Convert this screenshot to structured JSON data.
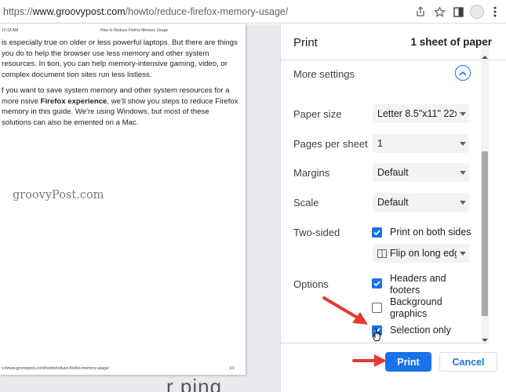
{
  "browser": {
    "url_scheme": "https://",
    "url_host": "www.groovypost.com",
    "url_path": "/howto/reduce-firefox-memory-usage/",
    "icons": [
      "share-icon",
      "star-icon",
      "sidebar-icon",
      "avatar",
      "more-vert-icon"
    ]
  },
  "preview": {
    "header_left": "10:18 AM",
    "header_center": "How to Reduce Firefox Memory Usage",
    "para1": "is especially true on older or less powerful laptops. But there are things you do to help the browser use less memory and other system resources. In tion, you can help memory-intensive gaming, video, or complex document tion sites run less listless.",
    "para2_a": "f you want to save system memory and other system resources for a more nsive ",
    "para2_b": "Firefox experience",
    "para2_c": ", we'll show you steps to reduce Firefox memory in this guide. We're using Windows, but most of these solutions can also be emented on a Mac.",
    "watermark": "groovyPost.com",
    "footer_left": "s://www.groovypost.com/howto/reduce-firefox-memory-usage/",
    "footer_right": "1/1",
    "bleed_text": "r  ping"
  },
  "print_panel": {
    "title": "Print",
    "sheet_count": "1 sheet of paper",
    "more_settings_label": "More settings",
    "paper_size": {
      "label": "Paper size",
      "value": "Letter 8.5\"x11\" 22x"
    },
    "pages_per_sheet": {
      "label": "Pages per sheet",
      "value": "1"
    },
    "margins": {
      "label": "Margins",
      "value": "Default"
    },
    "scale": {
      "label": "Scale",
      "value": "Default"
    },
    "two_sided": {
      "label": "Two-sided",
      "checkbox_label": "Print on both sides",
      "checked": true,
      "flip_value": "Flip on long edg"
    },
    "options": {
      "label": "Options",
      "headers_footers": {
        "label_1": "Headers and",
        "label_2": "footers",
        "checked": true
      },
      "background_graphics": {
        "label_1": "Background",
        "label_2": "graphics",
        "checked": false
      },
      "selection_only": {
        "label": "Selection only",
        "checked": true
      }
    },
    "print_button": "Print",
    "cancel_button": "Cancel"
  },
  "colors": {
    "accent": "#1a73e8",
    "annotation_arrow": "#e53935"
  }
}
